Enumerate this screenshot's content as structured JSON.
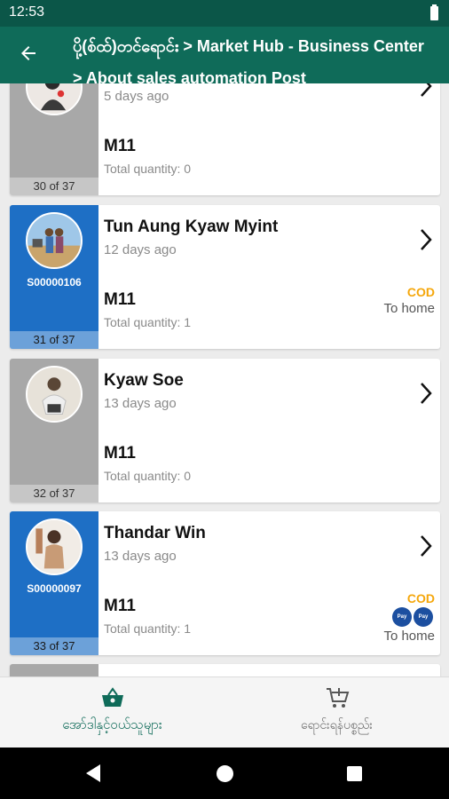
{
  "status_bar": {
    "time": "12:53"
  },
  "app_bar": {
    "title": "ပို့(စ်ထ်)တင်ရောင်း > Market Hub - Business Center > About sales automation Post"
  },
  "cards": [
    {
      "name": "",
      "ago": "5 days ago",
      "model": "M11",
      "qty": "Total quantity: 0",
      "counter": "30 of 37",
      "code": "",
      "cod": "",
      "delivery": "",
      "style": "gray"
    },
    {
      "name": "Tun Aung Kyaw Myint",
      "ago": "12 days ago",
      "model": "M11",
      "qty": "Total quantity: 1",
      "counter": "31 of 37",
      "code": "S00000106",
      "cod": "COD",
      "delivery": "To home",
      "style": "blue"
    },
    {
      "name": "Kyaw Soe",
      "ago": "13 days ago",
      "model": "M11",
      "qty": "Total quantity: 0",
      "counter": "32 of 37",
      "code": "",
      "cod": "",
      "delivery": "",
      "style": "gray"
    },
    {
      "name": "Thandar Win",
      "ago": "13 days ago",
      "model": "M11",
      "qty": "Total quantity: 1",
      "counter": "33 of 37",
      "code": "S00000097",
      "cod": "COD",
      "delivery": "To home",
      "style": "blue",
      "pay_icons": [
        "kpay-icon",
        "kpay-icon"
      ]
    }
  ],
  "bottom_nav": {
    "orders_label": "အော်ဒါနှင့်ဝယ်သူများ",
    "sales_label": "ရောင်းရန်ပစ္စည်း"
  },
  "colors": {
    "primary": "#0f6b59",
    "status_bar": "#0b5648",
    "card_blue": "#1e6fc5",
    "card_gray": "#a8a8a8",
    "cod": "#f5a70b"
  },
  "icons": [
    "back-arrow-icon",
    "chevron-right-icon",
    "basket-icon",
    "cart-icon",
    "battery-icon",
    "nav-back-icon",
    "nav-home-icon",
    "nav-recent-icon"
  ]
}
